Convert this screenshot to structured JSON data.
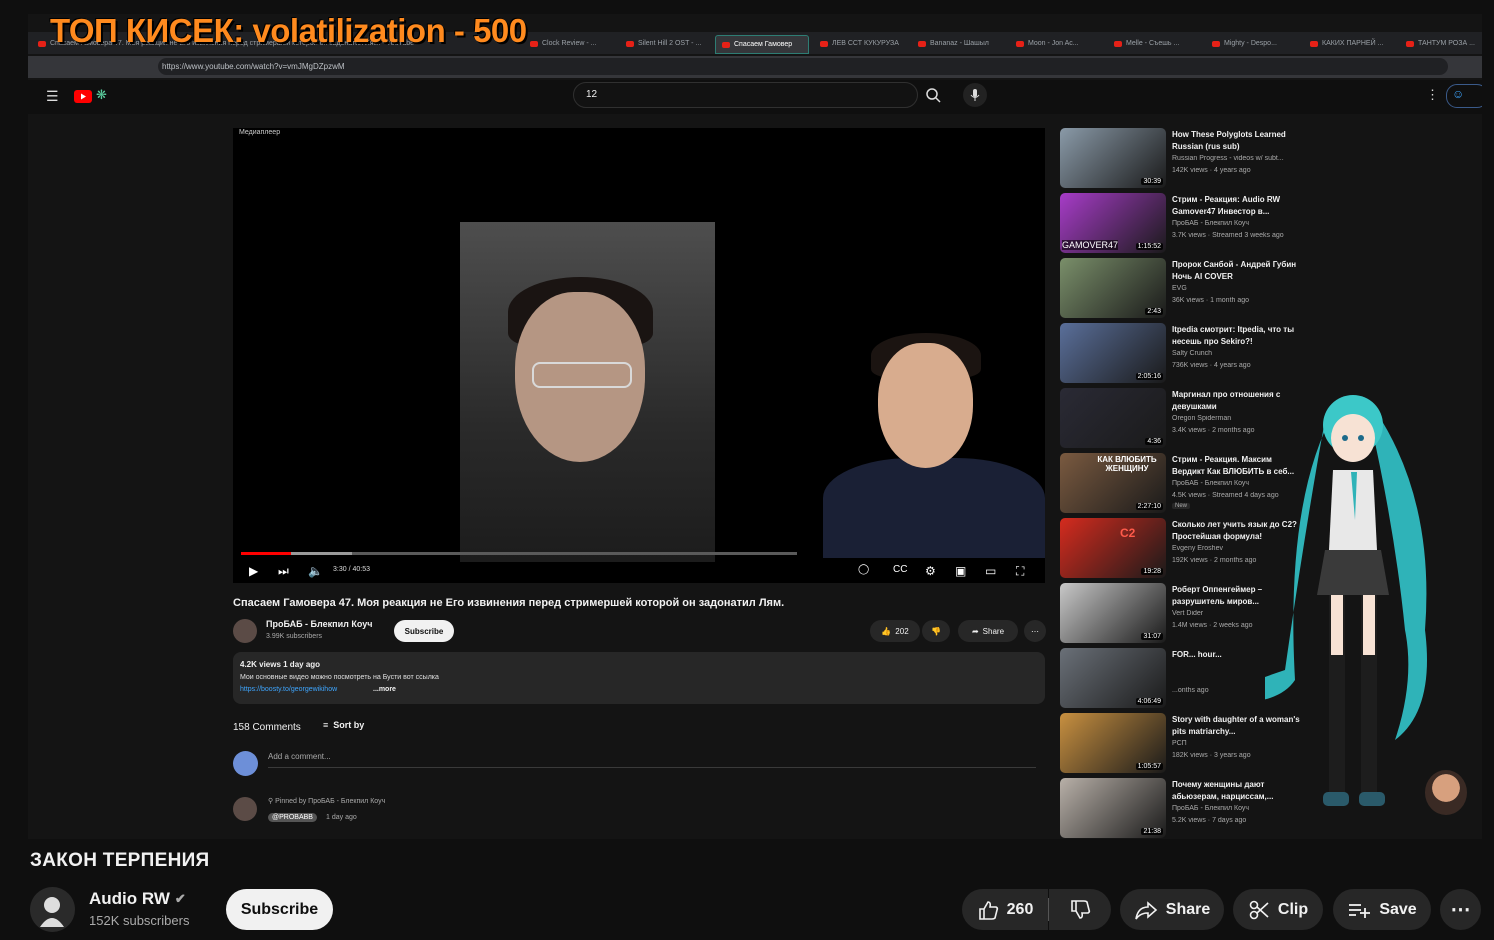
{
  "stream_overlay": {
    "title": "ТОП КИСЕК: volatilization - 500"
  },
  "browser": {
    "tabs": [
      {
        "label": "Спасаем Гамовера 47. Моя реакция не Его извинения перед стримершей которой он задонатил Лям. - YouTube"
      },
      {
        "label": "Clock Review - ..."
      },
      {
        "label": "Silent Hill 2 OST - ..."
      },
      {
        "label": "Спасаем Гамовер",
        "active": true
      },
      {
        "label": "ЛЕВ ССТ КУКУРУЗА"
      },
      {
        "label": "Bananaz - Шашыл"
      },
      {
        "label": "Moon - Jon Aс..."
      },
      {
        "label": "Melle - Съешь ..."
      },
      {
        "label": "Mighty - Despo..."
      },
      {
        "label": "КАКИХ ПАРНЕЙ ..."
      },
      {
        "label": "ТАНТУМ РОЗА ..."
      }
    ],
    "url": "https://www.youtube.com/watch?v=vmJMgDZpzwM"
  },
  "yt_inner": {
    "search_value": "12",
    "player": {
      "label": "Медиаплеер",
      "time": "3:30 / 40:53",
      "progress": 0.09,
      "buffered": 0.2
    },
    "video_title": "Спасаем Гамовера 47. Моя реакция не Его извинения перед стримершей которой он задонатил Лям.",
    "channel": {
      "name": "ПроБАБ - Блекпил Коуч",
      "subs": "3.99K subscribers",
      "subscribe": "Subscribe"
    },
    "likes": "202",
    "share": "Share",
    "description": {
      "meta": "4.2K views  1 day ago",
      "text": "Мои основные видео можно посмотреть на Бусти вот ссылка",
      "link": "https://boosty.to/georgewikihow",
      "more": "...more"
    },
    "comments_count": "158 Comments",
    "sort_by": "Sort by",
    "add_comment": "Add a comment...",
    "pinned": "Pinned by ПроБАБ - Блекпил Коуч",
    "pinned_handle": "@PROBABB",
    "pinned_date": "1 day ago"
  },
  "recommendations": [
    {
      "title": "How These Polyglots Learned Russian (rus sub)",
      "channel": "Russian Progress - videos w/ subt...",
      "meta": "142K views · 4 years ago",
      "duration": "30:39",
      "color": "#8a9aa8"
    },
    {
      "title": "Стрим - Реакция: Audio RW Gamover47 Инвестор в...",
      "channel": "ПроБАБ - Блекпил Коуч",
      "meta": "3.7K views · Streamed 3 weeks ago",
      "duration": "1:15:52",
      "color": "#a73cc8",
      "thumb_text": "GAMOVER47"
    },
    {
      "title": "Пророк Санбой - Андрей Губин Ночь AI COVER",
      "channel": "EVG",
      "meta": "36K views · 1 month ago",
      "duration": "2:43",
      "color": "#7a8f6a"
    },
    {
      "title": "Itpedia смотрит: Itpedia, что ты несешь про Sekiro?!",
      "channel": "Salty Crunch",
      "meta": "736K views · 4 years ago",
      "duration": "2:05:16",
      "color": "#5a6f9a"
    },
    {
      "title": "Маргинал про отношения с девушками",
      "channel": "Oregon Spiderman",
      "meta": "3.4K views · 2 months ago",
      "duration": "4:36",
      "color": "#2a2a35"
    },
    {
      "title": "Стрим - Реакция. Максим Вердикт Как ВЛЮБИТЬ в себ...",
      "channel": "ПроБАБ - Блекпил Коуч",
      "meta": "4.5K views · Streamed 4 days ago",
      "duration": "2:27:10",
      "color": "#7a5a40",
      "thumb_text": "КАК ВЛЮБИТЬ ЖЕНЩИНУ",
      "badge": "New"
    },
    {
      "title": "Сколько лет учить язык до C2? Простейшая формула!",
      "channel": "Evgeny Eroshev",
      "meta": "192K views · 2 months ago",
      "duration": "19:28",
      "color": "#d52b1e",
      "thumb_text": "C2"
    },
    {
      "title": "Роберт Оппенгеймер – разрушитель миров...",
      "channel": "Vert Dider",
      "meta": "1.4M views · 2 weeks ago",
      "duration": "31:07",
      "color": "#c8c8c8"
    },
    {
      "title": "FOR... hour...",
      "channel": "",
      "meta": "...onths ago",
      "duration": "4:06:49",
      "color": "#6a7078"
    },
    {
      "title": "Story with daughter of a woman's pits matriarchy...",
      "channel": "РСП",
      "meta": "182K views · 3 years ago",
      "duration": "1:05:57",
      "color": "#c89040"
    },
    {
      "title": "Почему женщины дают абьюзерам, нарциссам,...",
      "channel": "ПроБАБ - Блекпил Коуч",
      "meta": "5.2K views · 7 days ago",
      "duration": "21:38",
      "color": "#b8b0a8"
    }
  ],
  "outer": {
    "title": "ЗАКОН ТЕРПЕНИЯ",
    "channel_name": "Audio RW",
    "subscribers": "152K subscribers",
    "subscribe": "Subscribe",
    "likes": "260",
    "share": "Share",
    "clip": "Clip",
    "save": "Save"
  }
}
